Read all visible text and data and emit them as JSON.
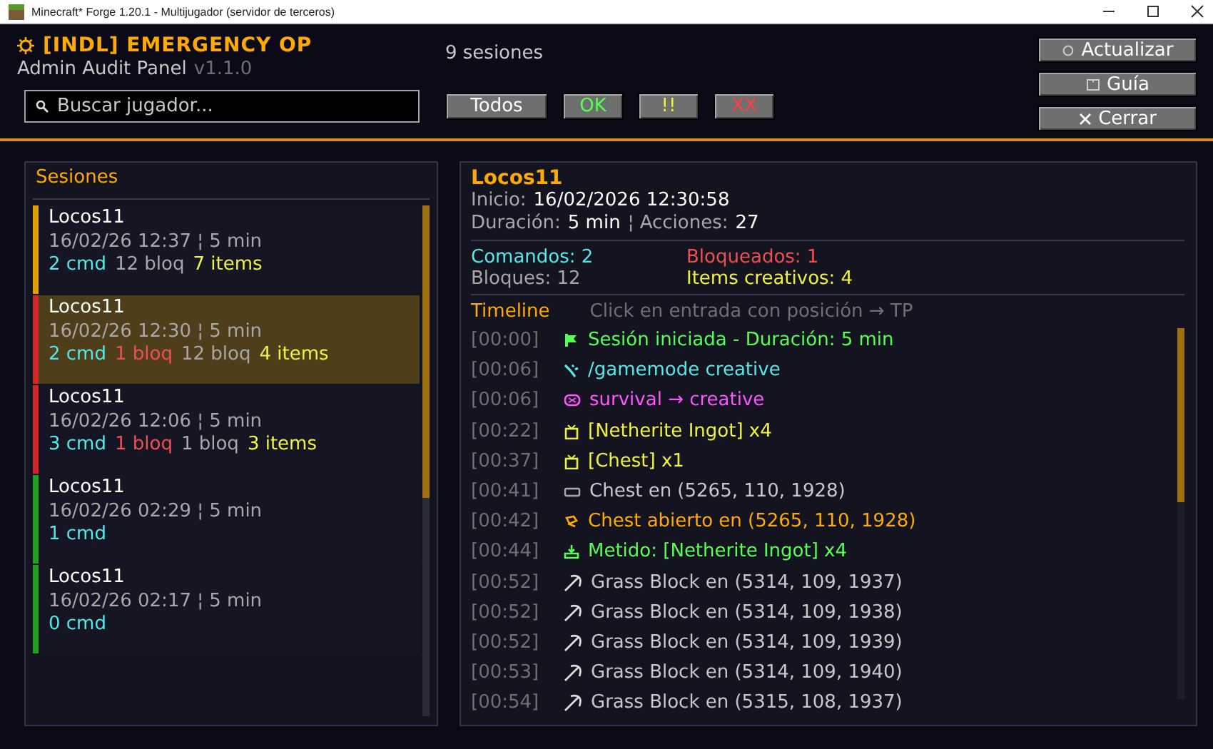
{
  "window": {
    "title": "Minecraft* Forge 1.20.1 - Multijugador (servidor de terceros)"
  },
  "header": {
    "title": "[INDL] EMERGENCY OP",
    "subtitle": "Admin Audit Panel",
    "version": "v1.1.0",
    "session_count": "9 sesiones"
  },
  "search": {
    "placeholder": "Buscar jugador..."
  },
  "filters": [
    {
      "label": "Todos",
      "kind": "all"
    },
    {
      "label": "OK",
      "kind": "ok"
    },
    {
      "label": "!!",
      "kind": "warn"
    },
    {
      "label": "XX",
      "kind": "bad"
    }
  ],
  "actions": [
    {
      "label": "Actualizar",
      "kind": "refresh"
    },
    {
      "label": "Guía",
      "kind": "guide"
    },
    {
      "label": "Cerrar",
      "kind": "close"
    }
  ],
  "sessions_panel": {
    "title": "Sesiones",
    "items": [
      {
        "name": "Locos11",
        "meta": "16/02/26 12:37 ¦ 5 min",
        "color": "#e0a000",
        "selected": false,
        "stats": [
          {
            "text": "2 cmd",
            "kind": "cmd"
          },
          {
            "text": "12 bloq",
            "kind": "blocks"
          },
          {
            "text": "7 items",
            "kind": "items"
          }
        ]
      },
      {
        "name": "Locos11",
        "meta": "16/02/26 12:30 ¦ 5 min",
        "color": "#d02828",
        "selected": true,
        "stats": [
          {
            "text": "2 cmd",
            "kind": "cmd"
          },
          {
            "text": "1 bloq",
            "kind": "blocked"
          },
          {
            "text": "12 bloq",
            "kind": "blocks"
          },
          {
            "text": "4 items",
            "kind": "items"
          }
        ]
      },
      {
        "name": "Locos11",
        "meta": "16/02/26 12:06 ¦ 5 min",
        "color": "#d02828",
        "selected": false,
        "stats": [
          {
            "text": "3 cmd",
            "kind": "cmd"
          },
          {
            "text": "1 bloq",
            "kind": "blocked"
          },
          {
            "text": "1 bloq",
            "kind": "blocks"
          },
          {
            "text": "3 items",
            "kind": "items"
          }
        ]
      },
      {
        "name": "Locos11",
        "meta": "16/02/26 02:29 ¦ 5 min",
        "color": "#20a020",
        "selected": false,
        "stats": [
          {
            "text": "1 cmd",
            "kind": "cmd"
          }
        ]
      },
      {
        "name": "Locos11",
        "meta": "16/02/26 02:17 ¦ 5 min",
        "color": "#20a020",
        "selected": false,
        "stats": [
          {
            "text": "0 cmd",
            "kind": "cmd"
          }
        ]
      }
    ]
  },
  "detail": {
    "name": "Locos11",
    "info": [
      [
        {
          "label": "Inicio:",
          "value": "16/02/2026 12:30:58"
        }
      ],
      [
        {
          "label": "Duración:",
          "value": "5 min"
        },
        {
          "label": "¦ Acciones:",
          "value": "27"
        }
      ]
    ],
    "stats": [
      {
        "text": "Comandos: 2",
        "kind": "cmd"
      },
      {
        "text": "Bloqueados: 1",
        "kind": "blocked"
      },
      {
        "text": "Bloques: 12",
        "kind": "blocks"
      },
      {
        "text": "Items creativos: 4",
        "kind": "items"
      }
    ],
    "timeline_title": "Timeline",
    "timeline_hint": "Click en entrada con posición → TP",
    "timeline": [
      {
        "time": "[00:00]",
        "text": "Sesión iniciada - Duración: 5 min",
        "kind": "start"
      },
      {
        "time": "[00:06]",
        "text": "/gamemode creative",
        "kind": "command"
      },
      {
        "time": "[00:06]",
        "text": "survival → creative",
        "kind": "gamemode"
      },
      {
        "time": "[00:22]",
        "text": "[Netherite Ingot] x4",
        "kind": "item"
      },
      {
        "time": "[00:37]",
        "text": "[Chest] x1",
        "kind": "item"
      },
      {
        "time": "[00:41]",
        "text": "Chest en (5265, 110, 1928)",
        "kind": "place"
      },
      {
        "time": "[00:42]",
        "text": "Chest abierto en (5265, 110, 1928)",
        "kind": "open"
      },
      {
        "time": "[00:44]",
        "text": "Metido: [Netherite Ingot] x4",
        "kind": "deposit"
      },
      {
        "time": "[00:52]",
        "text": "Grass Block en (5314, 109, 1937)",
        "kind": "break"
      },
      {
        "time": "[00:52]",
        "text": "Grass Block en (5314, 109, 1938)",
        "kind": "break"
      },
      {
        "time": "[00:52]",
        "text": "Grass Block en (5314, 109, 1939)",
        "kind": "break"
      },
      {
        "time": "[00:53]",
        "text": "Grass Block en (5314, 109, 1940)",
        "kind": "break"
      },
      {
        "time": "[00:54]",
        "text": "Grass Block en (5315, 108, 1937)",
        "kind": "break"
      }
    ]
  }
}
